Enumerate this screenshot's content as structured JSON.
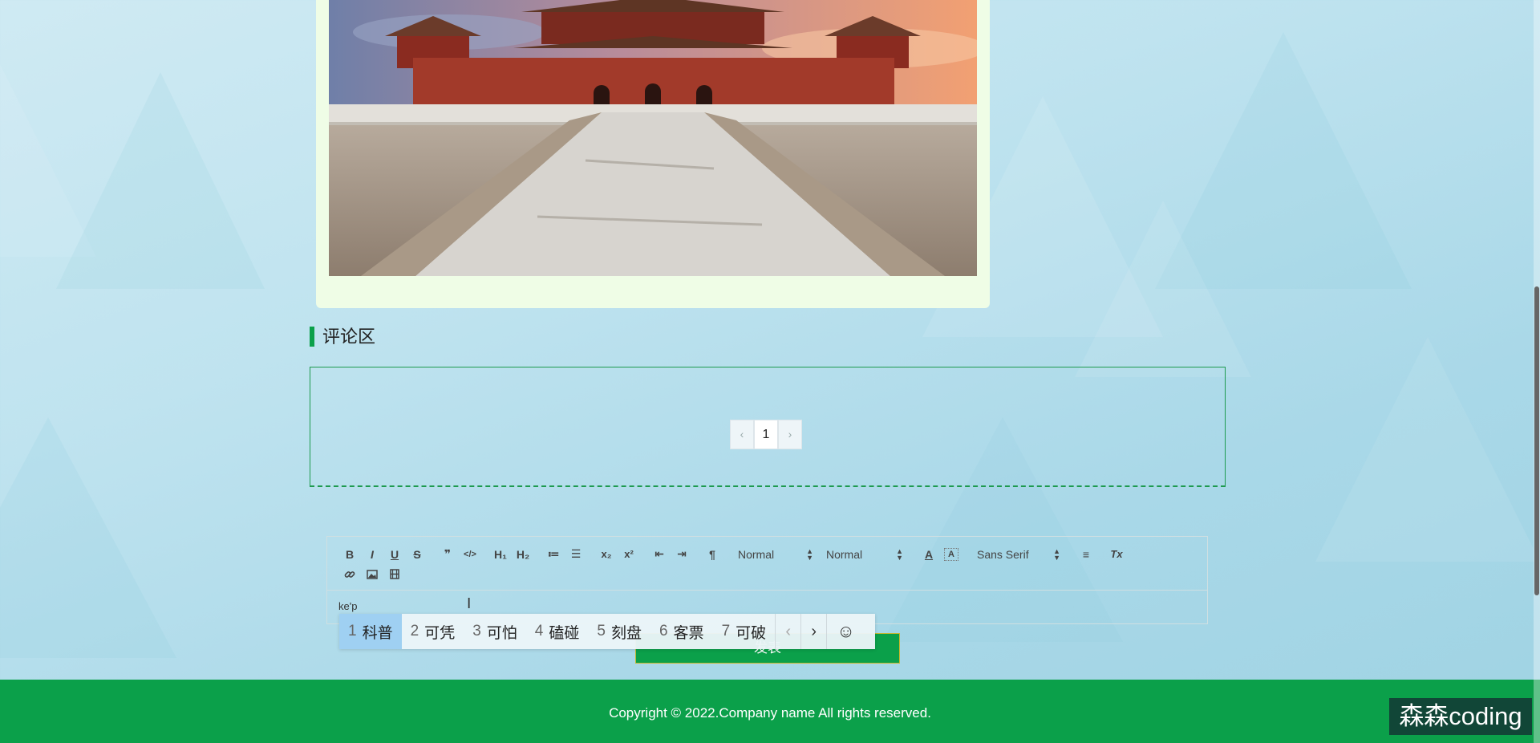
{
  "comments": {
    "section_title": "评论区",
    "pager": {
      "prev": "‹",
      "current": "1",
      "next": "›"
    }
  },
  "editor": {
    "toolbar": {
      "bold": "B",
      "italic": "I",
      "underline": "U",
      "strike": "S",
      "blockquote": "❞",
      "code": "</>",
      "h1": "H₁",
      "h2": "H₂",
      "ordered_list": "≔",
      "bullet_list": "☰",
      "subscript": "x₂",
      "superscript": "x²",
      "outdent": "⇤",
      "indent": "⇥",
      "direction": "¶",
      "size_picker": "Normal",
      "header_picker": "Normal",
      "color": "A",
      "background": "A",
      "font_picker": "Sans Serif",
      "align": "≡",
      "clean": "Tx"
    },
    "content": "ke'p"
  },
  "ime": {
    "candidates": [
      {
        "num": "1",
        "text": "科普"
      },
      {
        "num": "2",
        "text": "可凭"
      },
      {
        "num": "3",
        "text": "可怕"
      },
      {
        "num": "4",
        "text": "磕碰"
      },
      {
        "num": "5",
        "text": "刻盘"
      },
      {
        "num": "6",
        "text": "客票"
      },
      {
        "num": "7",
        "text": "可破"
      }
    ],
    "prev": "‹",
    "next": "›",
    "emoji": "☺"
  },
  "submit_button": "发表",
  "footer": {
    "copyright": "Copyright © 2022.Company name All rights reserved."
  },
  "watermark": "森森coding"
}
